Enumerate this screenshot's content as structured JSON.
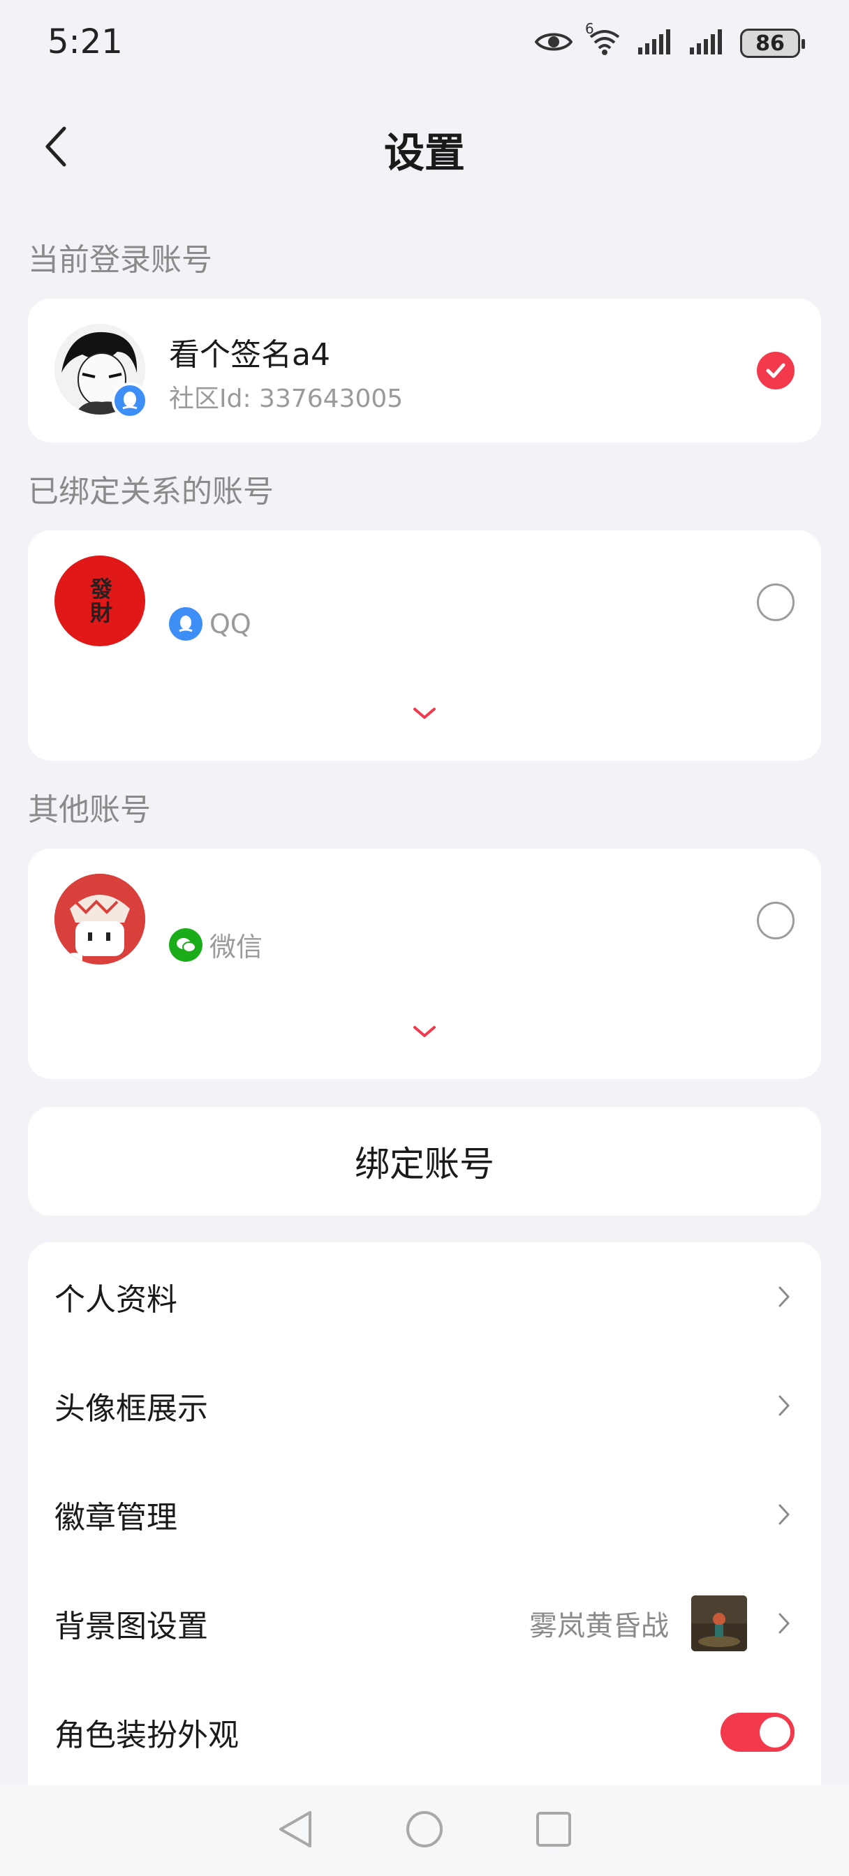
{
  "status": {
    "time": "5:21",
    "battery": "86",
    "wifi_label": "6"
  },
  "header": {
    "title": "设置"
  },
  "current_account": {
    "section_label": "当前登录账号",
    "name": "看个签名a4",
    "community_id": "社区Id: 337643005"
  },
  "bound_accounts": {
    "section_label": "已绑定关系的账号",
    "platform": "QQ",
    "avatar_text": "發財"
  },
  "other_accounts": {
    "section_label": "其他账号",
    "platform": "微信"
  },
  "bind_button": {
    "label": "绑定账号"
  },
  "menu": {
    "items": [
      {
        "label": "个人资料"
      },
      {
        "label": "头像框展示"
      },
      {
        "label": "徽章管理"
      },
      {
        "label": "背景图设置",
        "value": "雾岚黄昏战"
      },
      {
        "label": "角色装扮外观",
        "toggle": true
      }
    ]
  },
  "colors": {
    "accent": "#f23a4c",
    "qq_blue": "#3e8ef7",
    "wechat_green": "#1aad19"
  }
}
